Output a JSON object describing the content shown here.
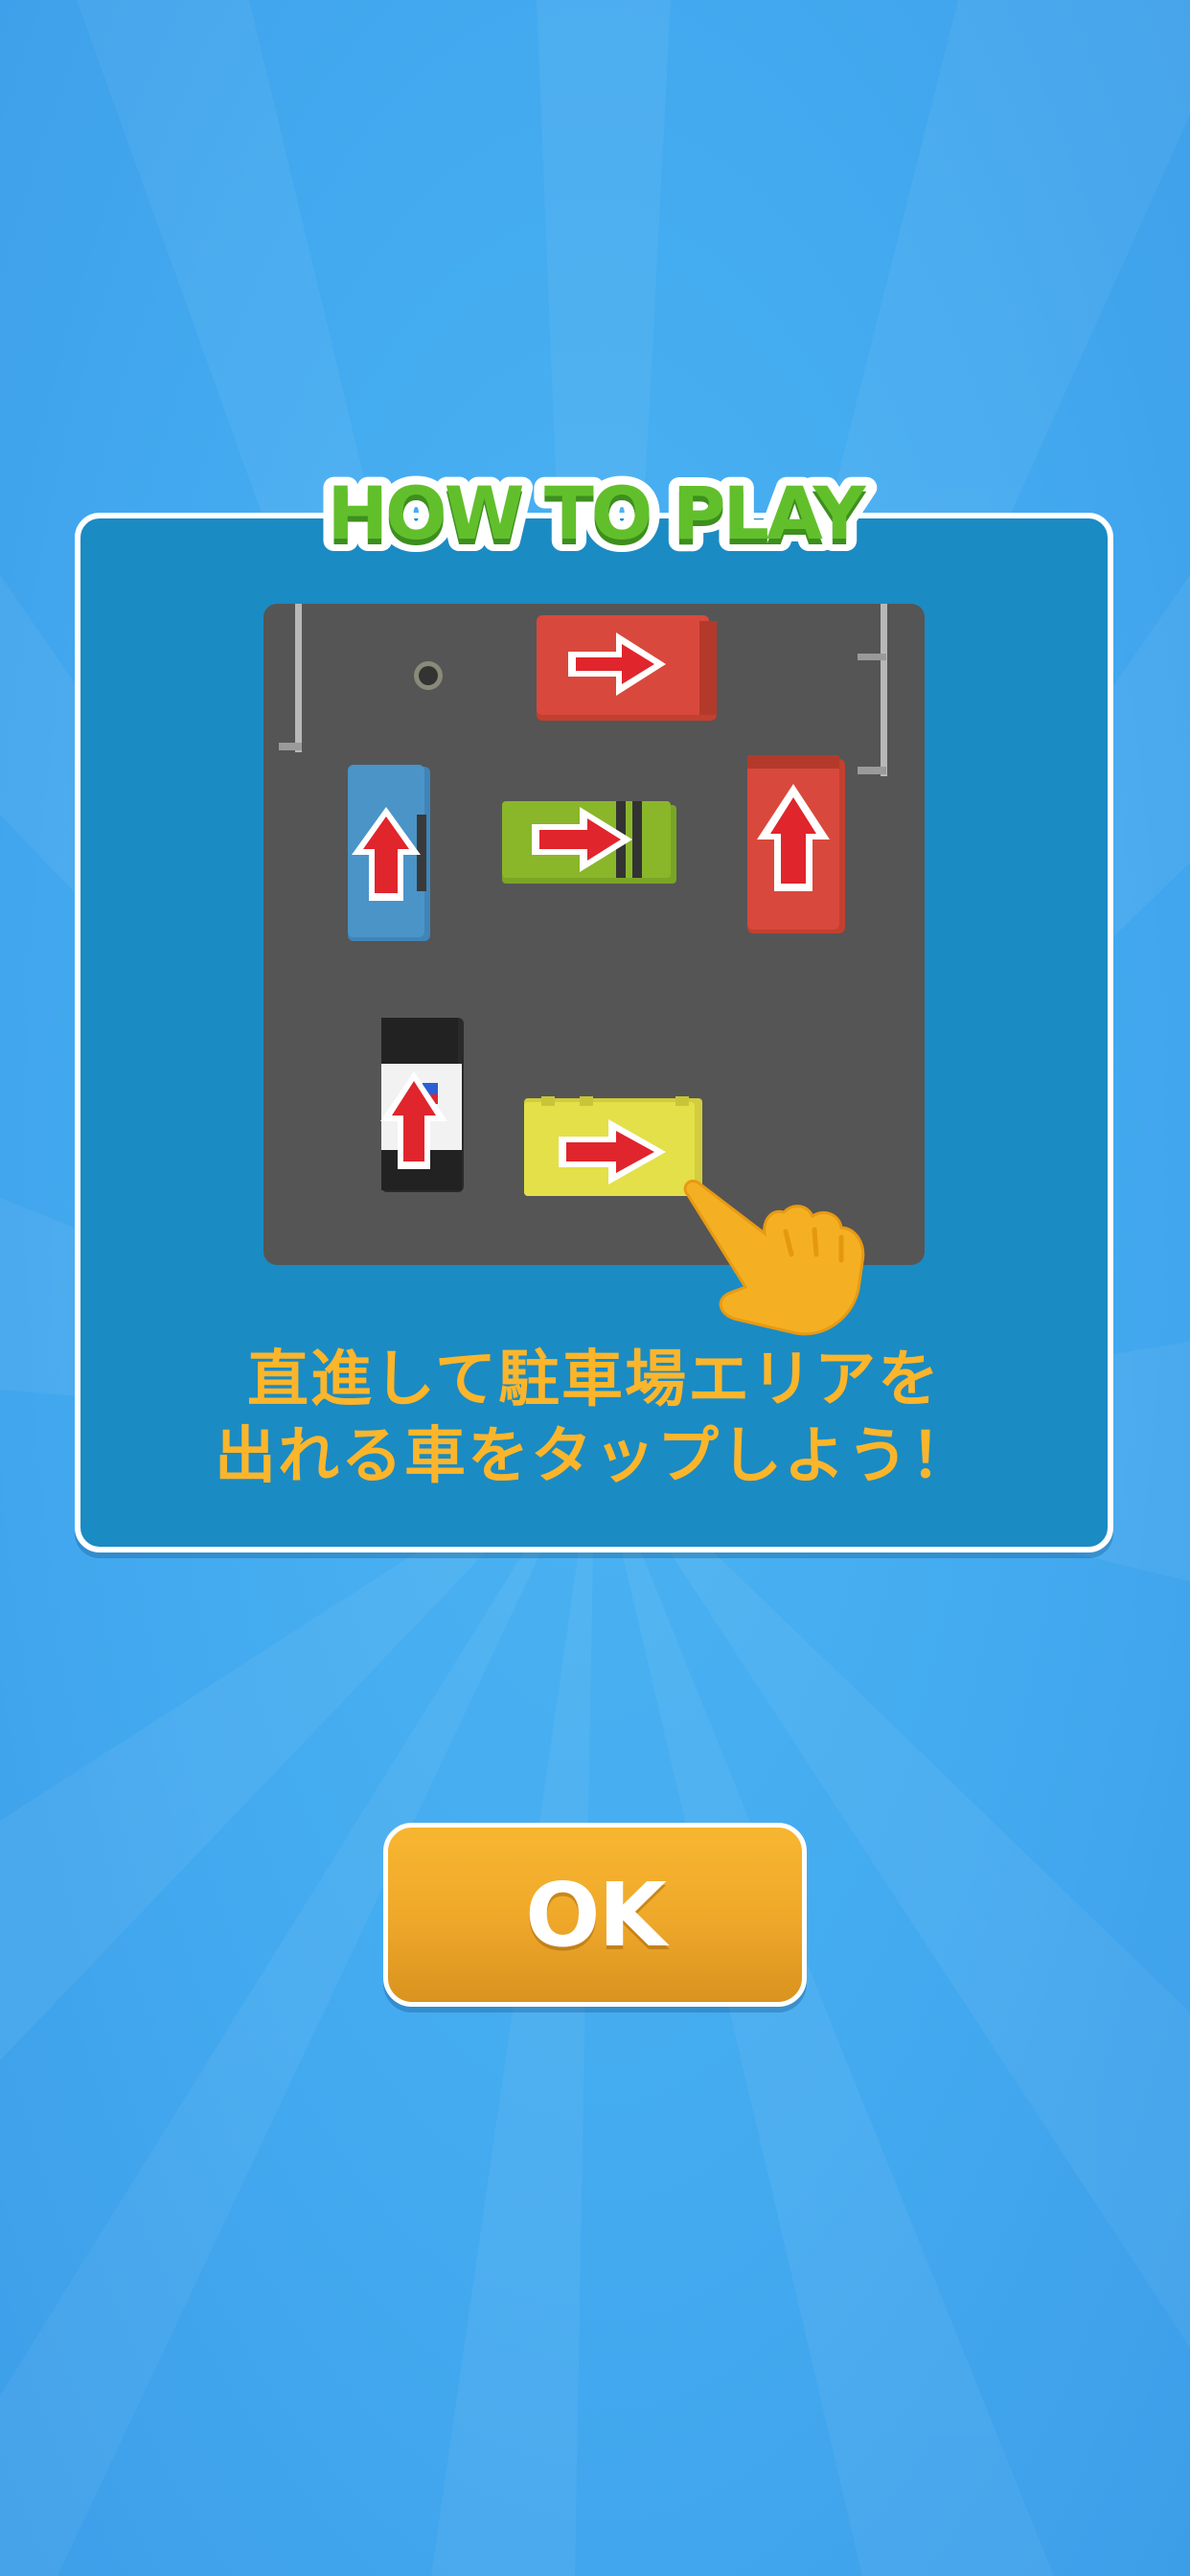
{
  "title": "HOW TO PLAY",
  "instruction": {
    "line1": "直進して駐車場エリアを",
    "line2": "出れる車をタップしよう！"
  },
  "ok_button": {
    "label": "OK"
  },
  "colors": {
    "background": "#43aaf0",
    "panel": "#1b8bc3",
    "title_green": "#5cb82a",
    "instruction_text": "#fbb52b",
    "ok_button": "#f0a92a",
    "board": "#555555"
  },
  "board": {
    "cars": [
      {
        "name": "red-car-top",
        "color": "#d9483c",
        "direction": "right"
      },
      {
        "name": "blue-car",
        "color": "#4a94c8",
        "direction": "up"
      },
      {
        "name": "green-car",
        "color": "#8ab62a",
        "direction": "right"
      },
      {
        "name": "red-car-right",
        "color": "#d9483c",
        "direction": "up"
      },
      {
        "name": "police-car",
        "color": "#ffffff",
        "direction": "up"
      },
      {
        "name": "yellow-car",
        "color": "#e3e04a",
        "direction": "right"
      }
    ]
  }
}
